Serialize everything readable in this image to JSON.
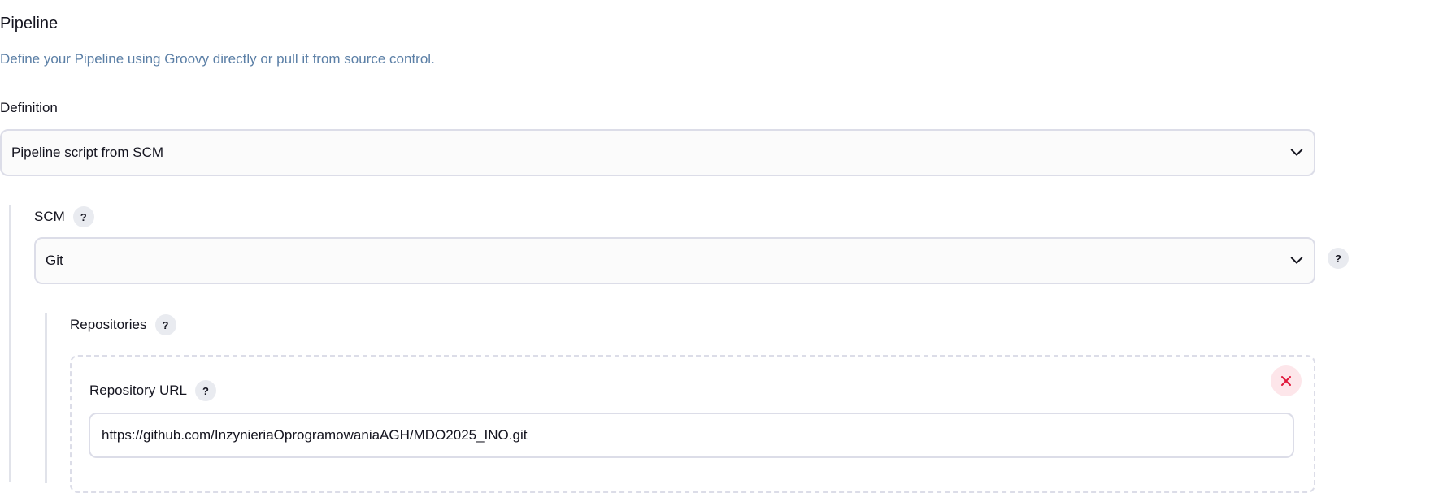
{
  "pipeline": {
    "title": "Pipeline",
    "description": "Define your Pipeline using Groovy directly or pull it from source control."
  },
  "definition": {
    "label": "Definition",
    "selected": "Pipeline script from SCM"
  },
  "scm": {
    "label": "SCM",
    "help": "?",
    "selected": "Git",
    "side_help": "?"
  },
  "repositories": {
    "label": "Repositories",
    "help": "?",
    "url_label": "Repository URL",
    "url_help": "?",
    "url_value": "https://github.com/InzynieriaOprogramowaniaAGH/MDO2025_INO.git"
  },
  "icons": {
    "chevron": "chevron-down-icon",
    "delete": "close-icon",
    "delete_color": "#e0173a"
  }
}
